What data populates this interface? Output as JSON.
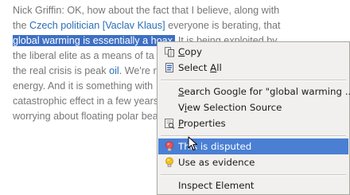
{
  "article": {
    "line1": "Nick Griffin: OK, how about the fact that I believe, along with",
    "line2_pre": "the ",
    "line2_link": "Czech politician [Vaclav Klaus]",
    "line2_post": " everyone is berating, that",
    "line3_selected": "global warming is essentially a hoax.",
    "line3_post": " It is being exploited by",
    "line4": "the liberal elite as a means of ta",
    "line5_pre": "the real crisis is peak ",
    "line5_link": "oil",
    "line5_post": ". We're r",
    "line6": "energy. And it is something with",
    "line7": "catastrophic effect in a few years",
    "line8": "worrying about floating polar bea"
  },
  "context_menu": {
    "copy": {
      "accel": "C",
      "rest": "opy"
    },
    "select_all": {
      "pre": "Select ",
      "accel": "A",
      "rest": "ll"
    },
    "search_google": {
      "accel": "S",
      "rest": "earch Google for \"global warming ...\""
    },
    "view_source": {
      "pre": "V",
      "accel": "i",
      "rest": "ew Selection Source"
    },
    "properties": {
      "accel": "P",
      "rest": "roperties"
    },
    "disputed": "This is disputed",
    "evidence": "Use as evidence",
    "inspect": "Inspect Element"
  },
  "icons": {
    "copy": "copy-icon",
    "select_all": "select-all-icon",
    "properties": "properties-icon",
    "disputed": "red-lightbulb-icon",
    "evidence": "yellow-lightbulb-icon",
    "cursor": "mouse-pointer-icon"
  },
  "colors": {
    "selection": "#3d6fc4",
    "link": "#2a6fb6",
    "menu_highlight": "#4a7fd4",
    "menu_background": "#f1f0ee"
  }
}
